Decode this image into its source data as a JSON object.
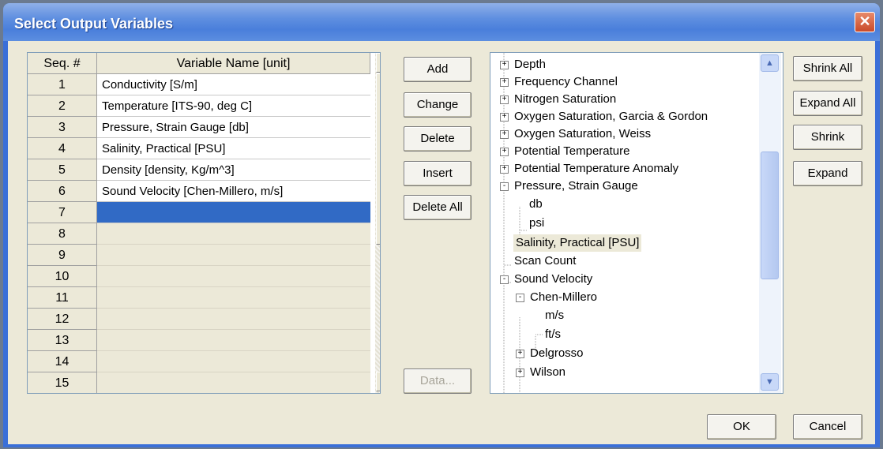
{
  "window": {
    "title": "Select Output Variables"
  },
  "grid": {
    "headers": {
      "seq": "Seq. #",
      "variable": "Variable Name [unit]"
    },
    "rows": [
      {
        "seq": "1",
        "variable": "Conductivity [S/m]"
      },
      {
        "seq": "2",
        "variable": "Temperature [ITS-90, deg C]"
      },
      {
        "seq": "3",
        "variable": "Pressure, Strain Gauge [db]"
      },
      {
        "seq": "4",
        "variable": "Salinity, Practical [PSU]"
      },
      {
        "seq": "5",
        "variable": "Density [density, Kg/m^3]"
      },
      {
        "seq": "6",
        "variable": "Sound Velocity [Chen-Millero, m/s]"
      },
      {
        "seq": "7",
        "variable": ""
      },
      {
        "seq": "8",
        "variable": ""
      },
      {
        "seq": "9",
        "variable": ""
      },
      {
        "seq": "10",
        "variable": ""
      },
      {
        "seq": "11",
        "variable": ""
      },
      {
        "seq": "12",
        "variable": ""
      },
      {
        "seq": "13",
        "variable": ""
      },
      {
        "seq": "14",
        "variable": ""
      },
      {
        "seq": "15",
        "variable": ""
      }
    ]
  },
  "edit_buttons": {
    "add": "Add",
    "change": "Change",
    "delete": "Delete",
    "insert": "Insert",
    "delete_all": "Delete All",
    "data": "Data..."
  },
  "tree": {
    "items": [
      {
        "label": "Depth",
        "toggle": "+"
      },
      {
        "label": "Frequency Channel",
        "toggle": "+"
      },
      {
        "label": "Nitrogen Saturation",
        "toggle": "+"
      },
      {
        "label": "Oxygen Saturation, Garcia & Gordon",
        "toggle": "+"
      },
      {
        "label": "Oxygen Saturation, Weiss",
        "toggle": "+"
      },
      {
        "label": "Potential Temperature",
        "toggle": "+"
      },
      {
        "label": "Potential Temperature Anomaly",
        "toggle": "+"
      },
      {
        "label": "Pressure, Strain Gauge",
        "toggle": "-"
      },
      {
        "label": "db",
        "toggle": ""
      },
      {
        "label": "psi",
        "toggle": ""
      },
      {
        "label": "Salinity, Practical [PSU]",
        "toggle": ""
      },
      {
        "label": "Scan Count",
        "toggle": ""
      },
      {
        "label": "Sound Velocity",
        "toggle": "-"
      },
      {
        "label": "Chen-Millero",
        "toggle": "-"
      },
      {
        "label": "m/s",
        "toggle": ""
      },
      {
        "label": "ft/s",
        "toggle": ""
      },
      {
        "label": "Delgrosso",
        "toggle": "+"
      },
      {
        "label": "Wilson",
        "toggle": "+"
      }
    ]
  },
  "tree_buttons": {
    "shrink_all": "Shrink All",
    "expand_all": "Expand All",
    "shrink": "Shrink",
    "expand": "Expand"
  },
  "dialog_buttons": {
    "ok": "OK",
    "cancel": "Cancel"
  }
}
